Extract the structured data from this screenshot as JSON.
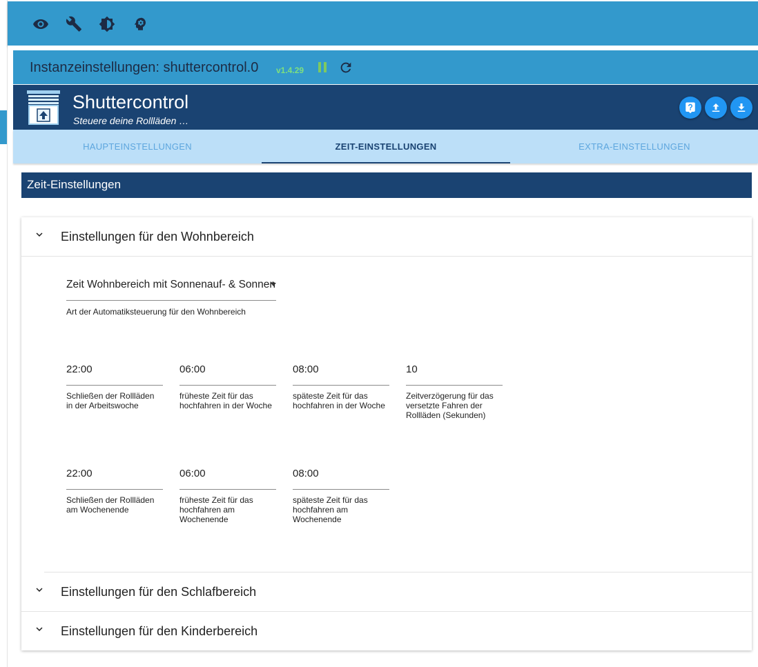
{
  "nav": {
    "icons": [
      "eye-icon",
      "wrench-icon",
      "brightness-icon",
      "head-icon"
    ]
  },
  "instance": {
    "title": "Instanzeinstellungen: shuttercontrol.0",
    "version": "v1.4.29"
  },
  "adapter": {
    "name": "Shuttercontrol",
    "description": "Steuere deine Rollläden …"
  },
  "tabs": [
    {
      "label": "HAUPTEINSTELLUNGEN",
      "active": false
    },
    {
      "label": "ZEIT-EINSTELLUNGEN",
      "active": true
    },
    {
      "label": "EXTRA-EINSTELLUNGEN",
      "active": false
    }
  ],
  "section": {
    "title": "Zeit-Einstellungen"
  },
  "accordion": {
    "living": {
      "label": "Einstellungen für den Wohnbereich",
      "select": {
        "value": "Zeit Wohnbereich mit Sonnenauf- & Sonnenuntergang",
        "help": "Art der Automatiksteuerung für den Wohnbereich"
      },
      "week_fields": [
        {
          "value": "22:00",
          "help": "Schließen der Rollläden in der Arbeitswoche"
        },
        {
          "value": "06:00",
          "help": "früheste Zeit für das hochfahren in der Woche"
        },
        {
          "value": "08:00",
          "help": "späteste Zeit für das hochfahren in der Woche"
        },
        {
          "value": "10",
          "help": "Zeitverzögerung für das versetzte Fahren der Rollläden (Sekunden)"
        }
      ],
      "weekend_fields": [
        {
          "value": "22:00",
          "help": "Schließen der Rollläden am Wochenende"
        },
        {
          "value": "06:00",
          "help": "früheste Zeit für das hochfahren am Wochenende"
        },
        {
          "value": "08:00",
          "help": "späteste Zeit für das hochfahren am Wochenende"
        }
      ]
    },
    "sleep": {
      "label": "Einstellungen für den Schlafbereich"
    },
    "children": {
      "label": "Einstellungen für den Kinderbereich"
    }
  },
  "colors": {
    "topbar": "#3399cc",
    "header": "#1a4372",
    "tabs": "#bcdff8",
    "version": "#7ee07e",
    "action_button": "#2196f3"
  }
}
